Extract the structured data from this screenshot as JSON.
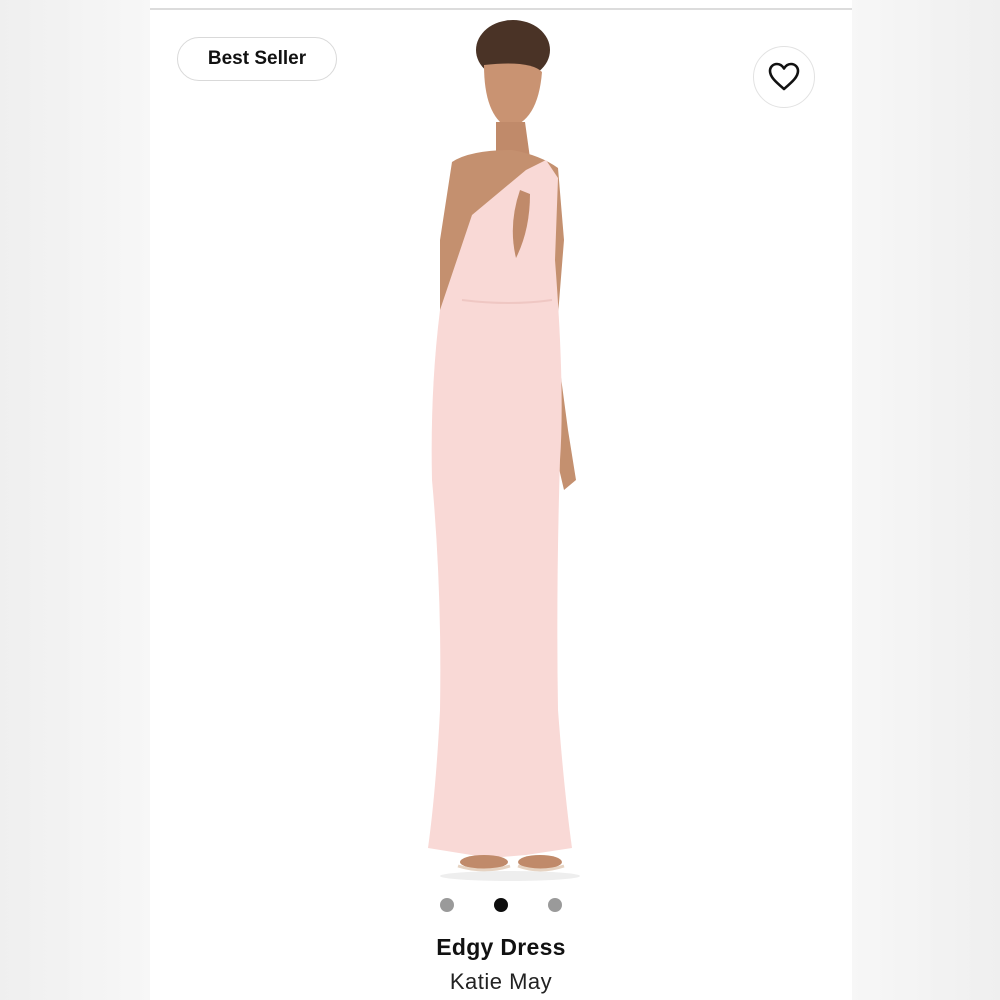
{
  "badge": {
    "label": "Best Seller"
  },
  "favorite": {
    "icon": "heart-icon"
  },
  "product": {
    "name": "Edgy Dress",
    "brand": "Katie May",
    "dress_color": "#f9d9d6"
  },
  "carousel": {
    "slides": 3,
    "active_index": 1
  }
}
